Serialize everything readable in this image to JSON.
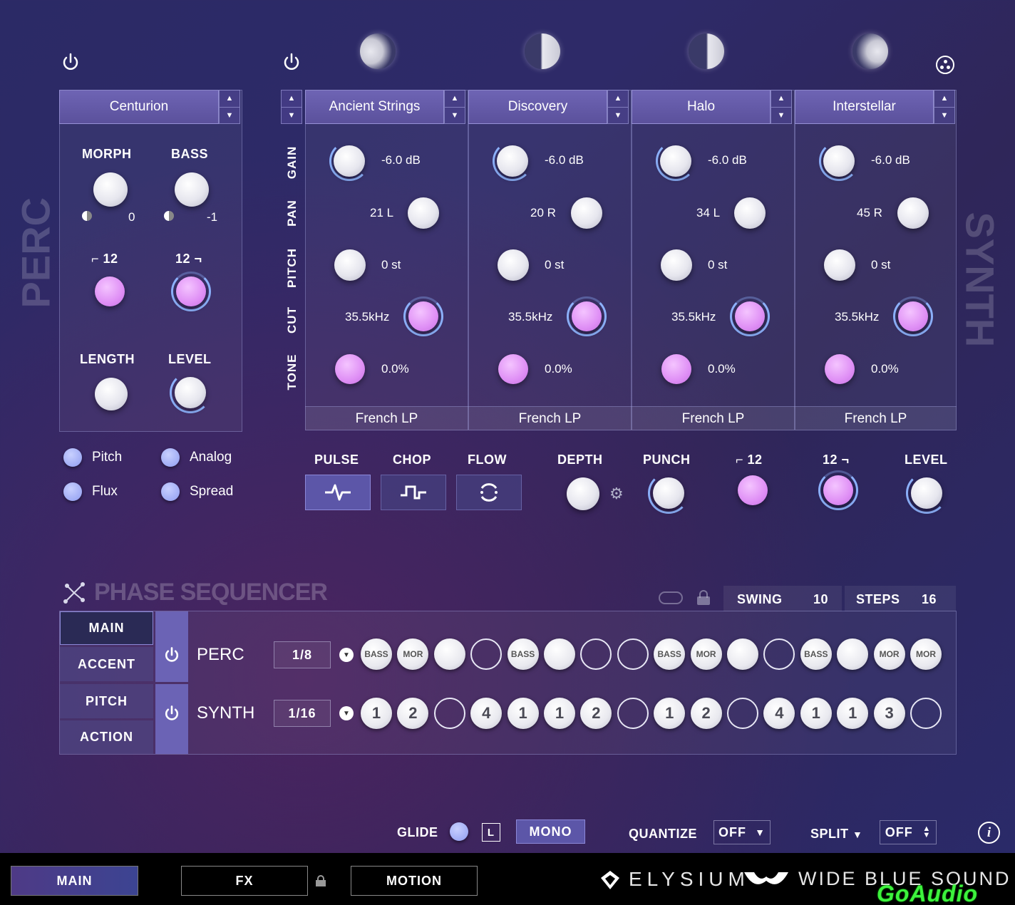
{
  "side": {
    "left": "PERC",
    "right": "SYNTH"
  },
  "perc": {
    "preset": "Centurion",
    "morph_label": "MORPH",
    "bass_label": "BASS",
    "morph_value": "0",
    "bass_value": "-1",
    "hp_label": "12",
    "lp_label": "12",
    "length_label": "LENGTH",
    "level_label": "LEVEL",
    "options": [
      {
        "label": "Pitch"
      },
      {
        "label": "Analog"
      },
      {
        "label": "Flux"
      },
      {
        "label": "Spread"
      }
    ]
  },
  "synth": {
    "row_labels": [
      "GAIN",
      "PAN",
      "PITCH",
      "CUT",
      "TONE"
    ],
    "layers": [
      {
        "name": "Ancient Strings",
        "gain": "-6.0 dB",
        "pan": "21 L",
        "pitch": "0 st",
        "cut": "35.5kHz",
        "tone": "0.0%",
        "filter": "French LP"
      },
      {
        "name": "Discovery",
        "gain": "-6.0 dB",
        "pan": "20 R",
        "pitch": "0 st",
        "cut": "35.5kHz",
        "tone": "0.0%",
        "filter": "French LP"
      },
      {
        "name": "Halo",
        "gain": "-6.0 dB",
        "pan": "34 L",
        "pitch": "0 st",
        "cut": "35.5kHz",
        "tone": "0.0%",
        "filter": "French LP"
      },
      {
        "name": "Interstellar",
        "gain": "-6.0 dB",
        "pan": "45 R",
        "pitch": "0 st",
        "cut": "35.5kHz",
        "tone": "0.0%",
        "filter": "French LP"
      }
    ],
    "modes": {
      "pulse": "PULSE",
      "chop": "CHOP",
      "flow": "FLOW"
    },
    "depth_label": "DEPTH",
    "punch_label": "PUNCH",
    "hp_label": "12",
    "lp_label": "12",
    "level_label": "LEVEL"
  },
  "sequencer": {
    "title": "PHASE SEQUENCER",
    "swing_label": "SWING",
    "swing_value": "10",
    "steps_label": "STEPS",
    "steps_value": "16",
    "tabs": [
      "MAIN",
      "ACCENT",
      "PITCH",
      "ACTION"
    ],
    "perc_label": "PERC",
    "perc_rate": "1/8",
    "synth_label": "SYNTH",
    "synth_rate": "1/16",
    "perc_steps": [
      "BASS",
      "MOR",
      "",
      "o",
      "BASS",
      "",
      "o",
      "o",
      "BASS",
      "MOR",
      "",
      "o",
      "BASS",
      "",
      "MOR",
      "MOR"
    ],
    "synth_steps": [
      "1",
      "2",
      "o",
      "4",
      "1",
      "1",
      "2",
      "o",
      "1",
      "2",
      "o",
      "4",
      "1",
      "1",
      "3",
      "o"
    ]
  },
  "footer": {
    "glide_label": "GLIDE",
    "l_label": "L",
    "mono_label": "MONO",
    "quantize_label": "QUANTIZE",
    "quantize_value": "OFF",
    "split_label": "SPLIT",
    "split_value": "OFF"
  },
  "bottom_nav": {
    "main": "MAIN",
    "fx": "FX",
    "motion": "MOTION"
  },
  "brand": {
    "elysium": "ELYSIUM",
    "company": "WIDE BLUE SOUND",
    "watermark": "GoAudio"
  },
  "colors": {
    "accent_pink": "#df8ff5",
    "accent_blue": "#8fb4ff",
    "header": "#6e64b4"
  }
}
